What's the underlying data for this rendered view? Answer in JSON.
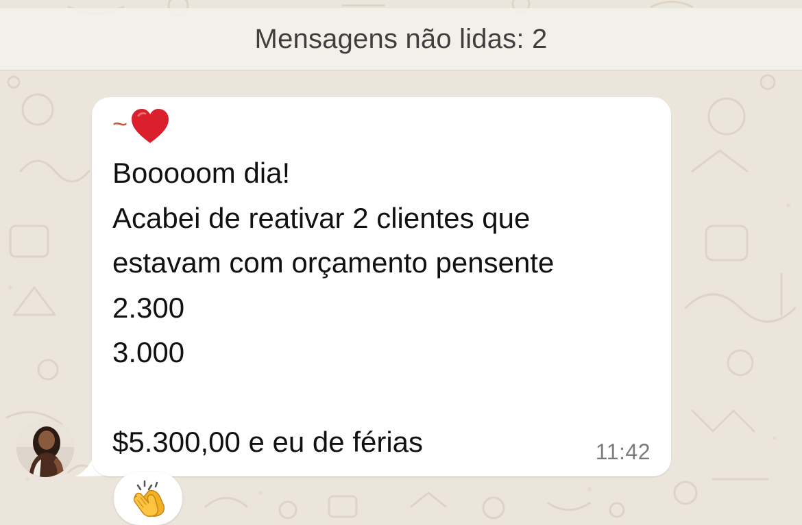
{
  "chat": {
    "unread_banner": "Mensagens não lidas: 2"
  },
  "message": {
    "sender_prefix": "~",
    "sender_emoji": "heart-icon",
    "text": "Booooom dia!\nAcabei de reativar 2 clientes que\nestavam com orçamento pensente\n2.300\n3.000\n\n$5.300,00 e eu de férias",
    "time": "11:42",
    "reaction": "clapping-hands-icon"
  },
  "colors": {
    "wallpaper": "#ece5dc",
    "bubble": "#ffffff",
    "sender_name": "#c6593c",
    "heart": "#d9202c",
    "text": "#111111",
    "timestamp": "#7c7c7c"
  }
}
